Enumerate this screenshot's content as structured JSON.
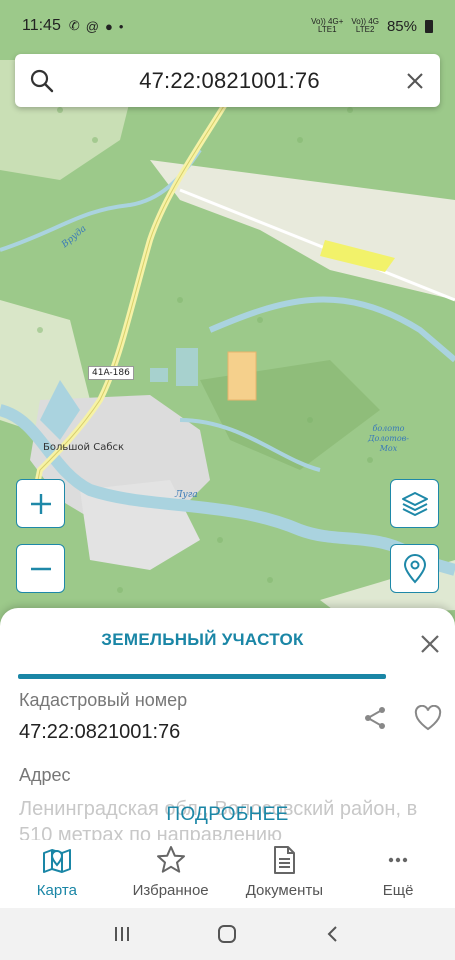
{
  "status_bar": {
    "time": "11:45",
    "sim1": "LTE1",
    "sim1_net": "Vo)) 4G+",
    "sim2": "LTE2",
    "sim2_net": "Vo)) 4G",
    "battery": "85%"
  },
  "search": {
    "value": "47:22:0821001:76"
  },
  "map": {
    "road_label": "41A-186",
    "town_label": "Большой Сабск",
    "river_label_1": "Луга",
    "river_label_2": "Вруда",
    "swamp_label_line1": "болото",
    "swamp_label_line2": "Долотов-",
    "swamp_label_line3": "Мох"
  },
  "map_controls": {
    "zoom_in": "+",
    "zoom_out": "−"
  },
  "sheet": {
    "title": "ЗЕМЕЛЬНЫЙ УЧАСТОК",
    "cad_label": "Кадастровый номер",
    "cad_value": "47:22:0821001:76",
    "addr_label": "Адрес",
    "addr_value": "Ленинградская обл., Волосовский район, в 510 метрах по направлению",
    "more_label": "ПОДРОБНЕЕ"
  },
  "nav": {
    "items": [
      {
        "label": "Карта"
      },
      {
        "label": "Избранное"
      },
      {
        "label": "Документы"
      },
      {
        "label": "Ещё"
      }
    ]
  },
  "colors": {
    "accent": "#1a86a6",
    "forest": "#8fc07a",
    "water": "#aad3df",
    "parcel_highlight": "#f5d08c"
  }
}
